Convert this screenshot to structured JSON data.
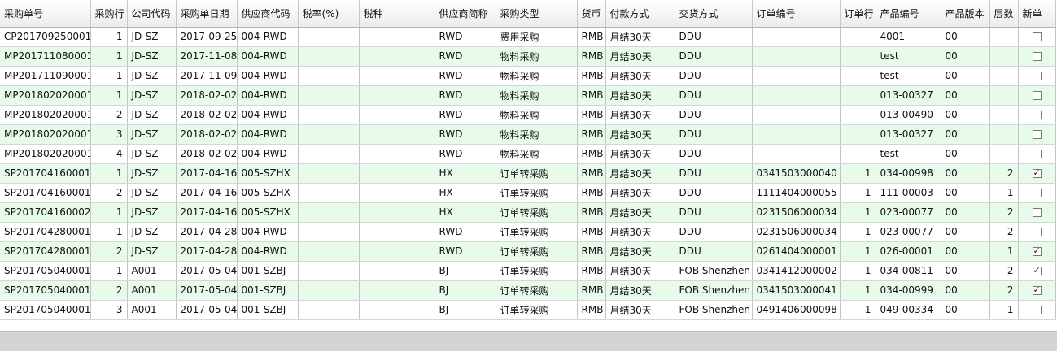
{
  "columns": [
    "采购单号",
    "采购行",
    "公司代码",
    "采购单日期",
    "供应商代码",
    "税率(%)",
    "税种",
    "供应商简称",
    "采购类型",
    "货币",
    "付款方式",
    "交货方式",
    "订单编号",
    "订单行",
    "产品编号",
    "产品版本",
    "层数",
    "新单"
  ],
  "rows": [
    [
      "CP201709250001",
      "1",
      "JD-SZ",
      "2017-09-25",
      "004-RWD",
      "",
      "",
      "RWD",
      "费用采购",
      "RMB",
      "月结30天",
      "DDU",
      "",
      "",
      "4001",
      "00",
      "",
      false
    ],
    [
      "MP201711080001",
      "1",
      "JD-SZ",
      "2017-11-08",
      "004-RWD",
      "",
      "",
      "RWD",
      "物料采购",
      "RMB",
      "月结30天",
      "DDU",
      "",
      "",
      "test",
      "00",
      "",
      false
    ],
    [
      "MP201711090001",
      "1",
      "JD-SZ",
      "2017-11-09",
      "004-RWD",
      "",
      "",
      "RWD",
      "物料采购",
      "RMB",
      "月结30天",
      "DDU",
      "",
      "",
      "test",
      "00",
      "",
      false
    ],
    [
      "MP201802020001",
      "1",
      "JD-SZ",
      "2018-02-02",
      "004-RWD",
      "",
      "",
      "RWD",
      "物料采购",
      "RMB",
      "月结30天",
      "DDU",
      "",
      "",
      "013-00327",
      "00",
      "",
      false
    ],
    [
      "MP201802020001",
      "2",
      "JD-SZ",
      "2018-02-02",
      "004-RWD",
      "",
      "",
      "RWD",
      "物料采购",
      "RMB",
      "月结30天",
      "DDU",
      "",
      "",
      "013-00490",
      "00",
      "",
      false
    ],
    [
      "MP201802020001",
      "3",
      "JD-SZ",
      "2018-02-02",
      "004-RWD",
      "",
      "",
      "RWD",
      "物料采购",
      "RMB",
      "月结30天",
      "DDU",
      "",
      "",
      "013-00327",
      "00",
      "",
      false
    ],
    [
      "MP201802020001",
      "4",
      "JD-SZ",
      "2018-02-02",
      "004-RWD",
      "",
      "",
      "RWD",
      "物料采购",
      "RMB",
      "月结30天",
      "DDU",
      "",
      "",
      "test",
      "00",
      "",
      false
    ],
    [
      "SP201704160001",
      "1",
      "JD-SZ",
      "2017-04-16",
      "005-SZHX",
      "",
      "",
      "HX",
      "订单转采购",
      "RMB",
      "月结30天",
      "DDU",
      "0341503000040",
      "1",
      "034-00998",
      "00",
      "2",
      true
    ],
    [
      "SP201704160001",
      "2",
      "JD-SZ",
      "2017-04-16",
      "005-SZHX",
      "",
      "",
      "HX",
      "订单转采购",
      "RMB",
      "月结30天",
      "DDU",
      "1111404000055",
      "1",
      "111-00003",
      "00",
      "1",
      false
    ],
    [
      "SP201704160002",
      "1",
      "JD-SZ",
      "2017-04-16",
      "005-SZHX",
      "",
      "",
      "HX",
      "订单转采购",
      "RMB",
      "月结30天",
      "DDU",
      "0231506000034",
      "1",
      "023-00077",
      "00",
      "2",
      false
    ],
    [
      "SP201704280001",
      "1",
      "JD-SZ",
      "2017-04-28",
      "004-RWD",
      "",
      "",
      "RWD",
      "订单转采购",
      "RMB",
      "月结30天",
      "DDU",
      "0231506000034",
      "1",
      "023-00077",
      "00",
      "2",
      false
    ],
    [
      "SP201704280001",
      "2",
      "JD-SZ",
      "2017-04-28",
      "004-RWD",
      "",
      "",
      "RWD",
      "订单转采购",
      "RMB",
      "月结30天",
      "DDU",
      "0261404000001",
      "1",
      "026-00001",
      "00",
      "1",
      true
    ],
    [
      "SP201705040001",
      "1",
      "A001",
      "2017-05-04",
      "001-SZBJ",
      "",
      "",
      "BJ",
      "订单转采购",
      "RMB",
      "月结30天",
      "FOB Shenzhen",
      "0341412000002",
      "1",
      "034-00811",
      "00",
      "2",
      true
    ],
    [
      "SP201705040001",
      "2",
      "A001",
      "2017-05-04",
      "001-SZBJ",
      "",
      "",
      "BJ",
      "订单转采购",
      "RMB",
      "月结30天",
      "FOB Shenzhen",
      "0341503000041",
      "1",
      "034-00999",
      "00",
      "2",
      true
    ],
    [
      "SP201705040001",
      "3",
      "A001",
      "2017-05-04",
      "001-SZBJ",
      "",
      "",
      "BJ",
      "订单转采购",
      "RMB",
      "月结30天",
      "FOB Shenzhen",
      "0491406000098",
      "1",
      "049-00334",
      "00",
      "1",
      false
    ]
  ]
}
